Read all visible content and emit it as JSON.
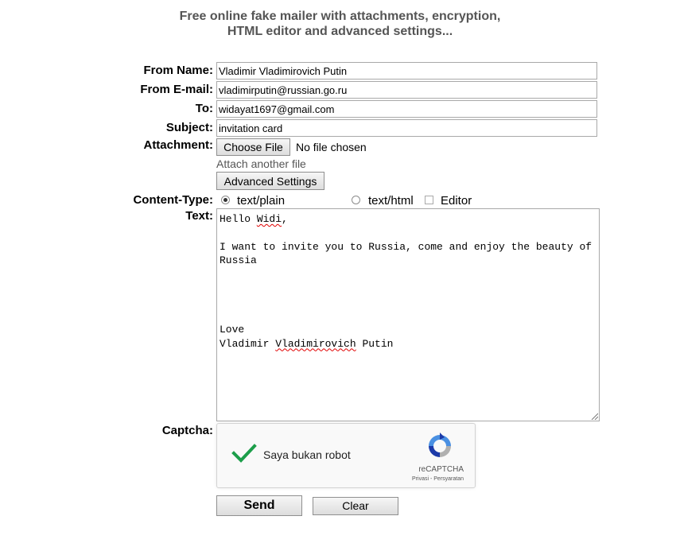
{
  "header": {
    "line1": "Free online fake mailer with attachments, encryption,",
    "line2": "HTML editor and advanced settings..."
  },
  "form": {
    "from_name_label": "From Name:",
    "from_name_value": "Vladimir Vladimirovich Putin",
    "from_email_label": "From E-mail:",
    "from_email_value": "vladimirputin@russian.go.ru",
    "to_label": "To:",
    "to_value": "widayat1697@gmail.com",
    "subject_label": "Subject:",
    "subject_value": "invitation card",
    "attachment_label": "Attachment:",
    "choose_file_label": "Choose File",
    "no_file_text": "No file chosen",
    "attach_another_text": "Attach another file",
    "advanced_settings_label": "Advanced Settings",
    "content_type_label": "Content-Type:",
    "content_type_options": [
      {
        "label": "text/plain",
        "selected": true
      },
      {
        "label": "text/html",
        "selected": false
      }
    ],
    "editor_label": "Editor",
    "editor_checked": false,
    "text_label": "Text:",
    "text_body": {
      "greeting_prefix": "Hello ",
      "greeting_name": "Widi",
      "greeting_suffix": ",",
      "body": "I want to invite you to Russia, come and enjoy the beauty of Russia",
      "closing": "Love",
      "signature_first": "Vladimir ",
      "signature_middle": "Vladimirovich",
      "signature_last": " Putin"
    },
    "captcha_label": "Captcha:",
    "captcha": {
      "checkbox_text": "Saya bukan robot",
      "brand": "reCAPTCHA",
      "links": "Privasi - Persyaratan",
      "checked": true,
      "check_color": "#1c9e4a"
    },
    "send_label": "Send",
    "clear_label": "Clear"
  }
}
